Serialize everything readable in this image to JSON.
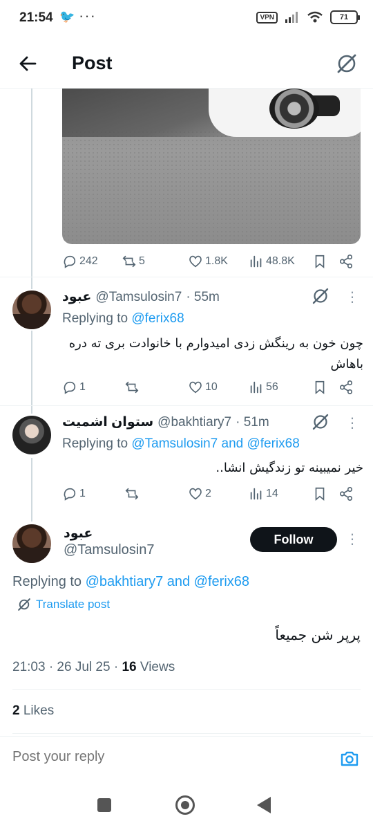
{
  "status_bar": {
    "time": "21:54",
    "vpn": "VPN",
    "battery": "71"
  },
  "header": {
    "title": "Post"
  },
  "original_post": {
    "stats": {
      "replies": "242",
      "reposts": "5",
      "likes": "1.8K",
      "views": "48.8K"
    }
  },
  "replies": [
    {
      "name": "عبود",
      "handle": "@Tamsulosin7",
      "time": "· 55m",
      "replying_prefix": "Replying to",
      "replying_to": "@ferix68",
      "text": "چون خون به رینگش زدی امیدوارم با خانوادت بری ته دره باهاش",
      "stats": {
        "replies": "1",
        "reposts": "",
        "likes": "10",
        "views": "56"
      }
    },
    {
      "name": "ستوان اشمیت",
      "handle": "@bakhtiary7",
      "time": "· 51m",
      "replying_prefix": "Replying to",
      "replying_to": "@Tamsulosin7 and @ferix68",
      "text": "خیر نمیبینه تو زندگیش انشا..",
      "stats": {
        "replies": "1",
        "reposts": "",
        "likes": "2",
        "views": "14"
      }
    }
  ],
  "main_post": {
    "name": "عبود",
    "handle": "@Tamsulosin7",
    "follow_label": "Follow",
    "replying_prefix": "Replying to",
    "replying_to": "@bakhtiary7 and @ferix68",
    "translate_label": "Translate post",
    "text": "پرپر شن جمیعاً",
    "timestamp": "21:03 · 26 Jul 25 ·",
    "views_count": "16",
    "views_label": "Views",
    "likes_count": "2",
    "likes_label": "Likes"
  },
  "reply_box": {
    "placeholder": "Post your reply"
  },
  "colors": {
    "link": "#1d9bf0",
    "muted": "#536471",
    "text": "#0f1419"
  }
}
